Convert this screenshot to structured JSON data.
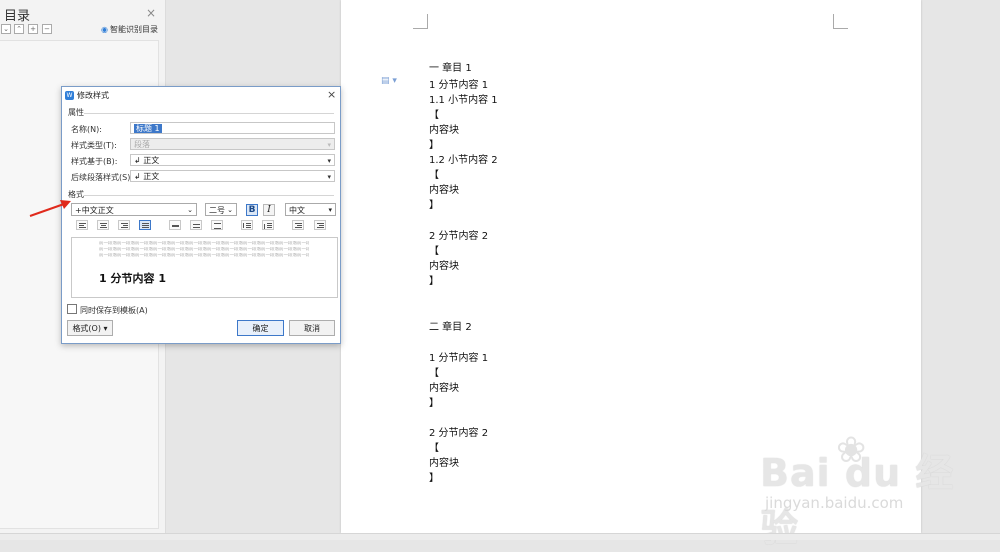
{
  "toc": {
    "title": "目录",
    "close": "×",
    "smart_label": "智能识别目录",
    "smart_icon": "eye-icon",
    "tool_icons": [
      "expand-icon",
      "collapse-icon",
      "add-icon",
      "remove-icon"
    ]
  },
  "document": {
    "paragraph_icon": "paragraph-icon",
    "lines": [
      "一  章目 1",
      "1  分节内容 1",
      "1.1  小节内容 1",
      "【",
      "内容块",
      "】",
      "1.2  小节内容 2",
      "【",
      "内容块",
      "】",
      "2  分节内容 2",
      "【",
      "内容块",
      "】",
      "二  章目 2",
      "1  分节内容 1",
      "【",
      "内容块",
      "】",
      "2  分节内容 2",
      "【",
      "内容块",
      "】"
    ]
  },
  "watermark": {
    "brand": "Bai  du 经验",
    "paw": "❀",
    "url": "jingyan.baidu.com"
  },
  "dialog": {
    "title": "修改样式",
    "close": "×",
    "properties_section": "属性",
    "fields": [
      {
        "label": "名称(N):",
        "value": "标题 1"
      },
      {
        "label": "样式类型(T):",
        "value": "段落"
      },
      {
        "label": "样式基于(B):",
        "value": "↲ 正文"
      },
      {
        "label": "后续段落样式(S):",
        "value": "↲ 正文"
      }
    ],
    "format_section": "格式",
    "font": "+中文正文",
    "size": "二号",
    "bold": "B",
    "italic": "I",
    "script": "中文",
    "preview_filler": "前一段落前一段落前一段落前一段落前一段落前一段落前一段落前一段落前一段落前一段落前一段落前一段落",
    "preview_heading": "1  分节内容 1",
    "save_template": "同时保存到模板(A)",
    "format_button": "格式(O)",
    "ok_button": "确定",
    "cancel_button": "取消"
  },
  "colors": {
    "accent": "#3d78c9",
    "arrow": "#e02a1c"
  }
}
